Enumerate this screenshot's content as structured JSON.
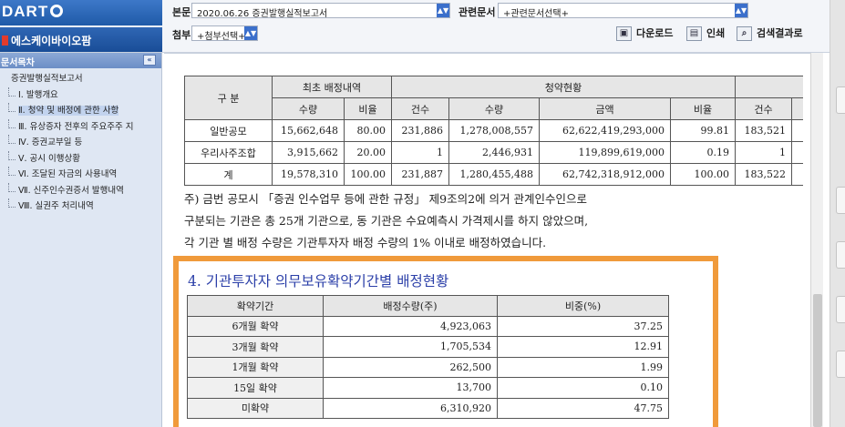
{
  "brand": {
    "logo_text": "DART"
  },
  "company": {
    "name": "에스케이바이오팜"
  },
  "header": {
    "main_doc_label": "본문",
    "main_doc_value": "2020.06.26  증권발행실적보고서",
    "related_doc_label": "관련문서",
    "related_doc_value": "+관련문서선택+",
    "attachment_label": "첨부",
    "attachment_value": "+첨부선택+",
    "download_label": "다운로드",
    "print_label": "인쇄",
    "search_results_label": "검색결과로"
  },
  "sidebar": {
    "title": "문서목차",
    "collapse_glyph": "«",
    "items": [
      {
        "label": "증권발행실적보고서"
      },
      {
        "label": "Ⅰ. 발행개요"
      },
      {
        "label": "Ⅱ. 청약 및 배정에 관한 사항"
      },
      {
        "label": "Ⅲ. 유상증자 전후의 주요주주 지"
      },
      {
        "label": "Ⅳ. 증권교부일 등"
      },
      {
        "label": "Ⅴ. 공시 이행상황"
      },
      {
        "label": "Ⅵ. 조달된 자금의 사용내역"
      },
      {
        "label": "Ⅶ. 신주인수권증서 발행내역"
      },
      {
        "label": "Ⅷ. 실권주 처리내역"
      }
    ]
  },
  "subscription_table": {
    "col_category": "구 분",
    "group_initial": "최초 배정내역",
    "group_status": "청약현황",
    "sub_headers": [
      "수량",
      "비율",
      "건수",
      "수량",
      "금액",
      "비율",
      "건수"
    ],
    "rows": [
      {
        "label": "일반공모",
        "cells": [
          "15,662,648",
          "80.00",
          "231,886",
          "1,278,008,557",
          "62,622,419,293,000",
          "99.81",
          "183,521"
        ]
      },
      {
        "label": "우리사주조합",
        "cells": [
          "3,915,662",
          "20.00",
          "1",
          "2,446,931",
          "119,899,619,000",
          "0.19",
          "1"
        ]
      },
      {
        "label": "계",
        "cells": [
          "19,578,310",
          "100.00",
          "231,887",
          "1,280,455,488",
          "62,742,318,912,000",
          "100.00",
          "183,522"
        ]
      }
    ]
  },
  "note": {
    "line1": "주) 금번 공모시 「증권 인수업무 등에 관한 규정」 제9조의2에 의거 관계인수인으로",
    "line2": "구분되는 기관은 총 25개 기관으로, 동 기관은 수요예측시 가격제시를 하지 않았으며,",
    "line3": "각 기관 별 배정 수량은 기관투자자 배정 수량의 1% 이내로 배정하였습니다."
  },
  "lockup": {
    "title": "4. 기관투자자 의무보유확약기간별 배정현황",
    "headers": [
      "확약기간",
      "배정수량(주)",
      "비중(%)"
    ],
    "rows": [
      {
        "period": "6개월 확약",
        "qty": "4,923,063",
        "pct": "37.25"
      },
      {
        "period": "3개월 확약",
        "qty": "1,705,534",
        "pct": "12.91"
      },
      {
        "period": "1개월 확약",
        "qty": "262,500",
        "pct": "1.99"
      },
      {
        "period": "15일 확약",
        "qty": "13,700",
        "pct": "0.10"
      },
      {
        "period": "미확약",
        "qty": "6,310,920",
        "pct": "47.75"
      }
    ]
  }
}
